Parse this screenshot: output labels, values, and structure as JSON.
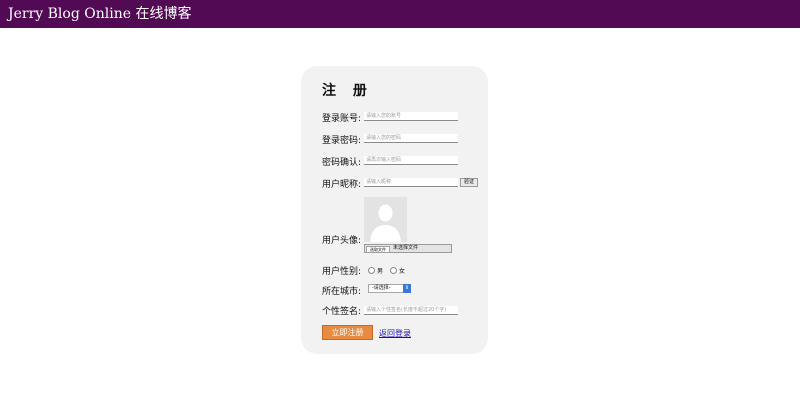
{
  "header": {
    "title": "Jerry Blog Online 在线博客"
  },
  "form": {
    "title": "注 册",
    "account": {
      "label": "登录账号:",
      "placeholder": "请输入您的账号"
    },
    "password": {
      "label": "登录密码:",
      "placeholder": "请输入您的密码"
    },
    "confirm": {
      "label": "密码确认:",
      "placeholder": "请再次输入密码"
    },
    "nickname": {
      "label": "用户昵称:",
      "placeholder": "请输入昵称",
      "verify_label": "验证"
    },
    "avatar": {
      "label": "用户头像:",
      "choose_file": "选取文件",
      "file_status": "未选择文件"
    },
    "gender": {
      "label": "用户性别:",
      "male": "男",
      "female": "女"
    },
    "city": {
      "label": "所在城市:",
      "selected": "-请选择-"
    },
    "signature": {
      "label": "个性签名:",
      "placeholder": "请输入个性签名(长度不超过20个字)"
    },
    "submit_label": "立即注册",
    "login_link": "返回登录"
  },
  "colors": {
    "header_bg": "#530a54",
    "submit_bg": "#e88a3f",
    "card_bg": "#f2f2f2"
  }
}
